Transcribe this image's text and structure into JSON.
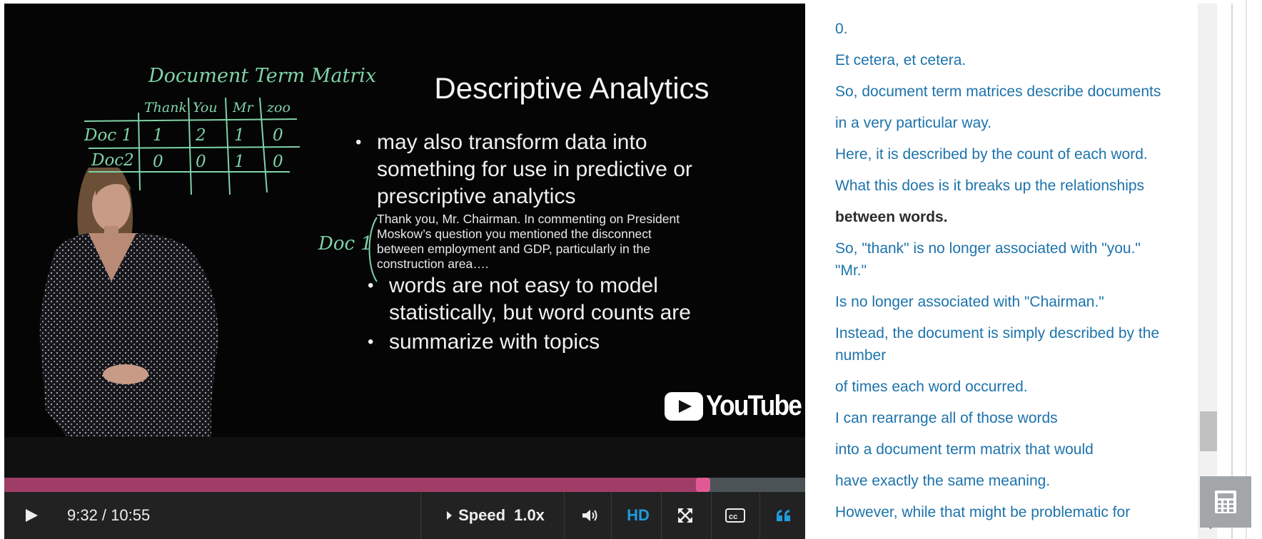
{
  "video": {
    "slide": {
      "title": "Descriptive Analytics",
      "bullets": [
        {
          "lines": [
            "may also transform data into",
            "something for use in predictive or",
            "prescriptive analytics"
          ]
        },
        {
          "lines": [
            "words are not easy to model",
            "statistically, but word counts are"
          ]
        },
        {
          "lines": [
            "summarize with topics"
          ]
        }
      ],
      "quote_lines": [
        "Thank you, Mr. Chairman.  In commenting on President",
        "Moskow’s question you mentioned the disconnect",
        "between employment and GDP, particularly in the",
        "construction area…."
      ]
    },
    "whiteboard": {
      "title": "Document Term Matrix",
      "header": [
        "Thank",
        "You",
        "Mr",
        "zoo"
      ],
      "rows": [
        {
          "label": "Doc 1",
          "cells": [
            "1",
            "2",
            "1",
            "0"
          ]
        },
        {
          "label": "Doc2",
          "cells": [
            "0",
            "0",
            "1",
            "0"
          ]
        }
      ],
      "side_note": "Doc 1",
      "ink_color": "#7fd3a6"
    },
    "watermark": {
      "icon": "youtube-play-icon",
      "text": "YouTube"
    }
  },
  "controls": {
    "play_icon": "play-icon",
    "time_display": "9:32 / 10:55",
    "progress_fraction": 0.8725,
    "speed_label": "Speed",
    "speed_value": "1.0x",
    "volume_icon": "volume-icon",
    "hd_label": "HD",
    "fullscreen_icon": "fullscreen-icon",
    "cc_icon": "closed-captions-icon",
    "transcript_icon": "transcript-quote-icon",
    "colors": {
      "progress_fill": "#a03d67",
      "progress_handle": "#e05995",
      "hd_active": "#1f9bde"
    }
  },
  "transcript": {
    "current_index": 6,
    "lines": [
      "0.",
      "Et cetera, et cetera.",
      "So, document term matrices describe documents",
      "in a very particular way.",
      "Here, it is described by the count of each word.",
      "What this does is it breaks up the relationships",
      "between words.",
      "So, \"thank\" is no longer associated with \"you.\" \"Mr.\"",
      "Is no longer associated with \"Chairman.\"",
      "Instead, the document is simply described by the number",
      "of times each word occurred.",
      "I can rearrange all of those words",
      "into a document term matrix that would",
      "have exactly the same meaning.",
      "However, while that might be problematic for"
    ],
    "colors": {
      "link": "#1d73ab",
      "current": "#2b2b2b"
    }
  },
  "calculator": {
    "icon": "calculator-icon"
  }
}
